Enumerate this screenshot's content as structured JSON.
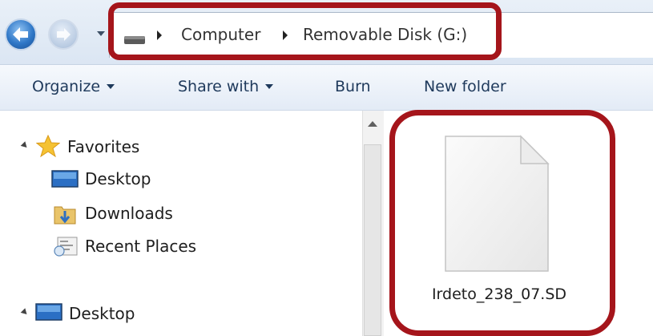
{
  "address_bar": {
    "breadcrumbs": [
      "Computer",
      "Removable Disk (G:)"
    ],
    "icons": [
      "back-arrow-icon",
      "forward-arrow-icon",
      "drive-icon",
      "chevron-right-icon"
    ]
  },
  "toolbar": {
    "organize_label": "Organize",
    "share_label": "Share with",
    "burn_label": "Burn",
    "new_folder_label": "New folder"
  },
  "nav_pane": {
    "favorites_label": "Favorites",
    "items": [
      {
        "label": "Desktop",
        "icon": "desktop-icon"
      },
      {
        "label": "Downloads",
        "icon": "downloads-folder-icon"
      },
      {
        "label": "Recent Places",
        "icon": "recent-places-icon"
      }
    ],
    "desktop_root_label": "Desktop"
  },
  "content": {
    "files": [
      {
        "name": "Irdeto_238_07.SD",
        "icon": "blank-file-icon"
      }
    ]
  },
  "colors": {
    "highlight": "#a5151b",
    "toolbar_text": "#1e395b",
    "star": "#f5c232"
  }
}
